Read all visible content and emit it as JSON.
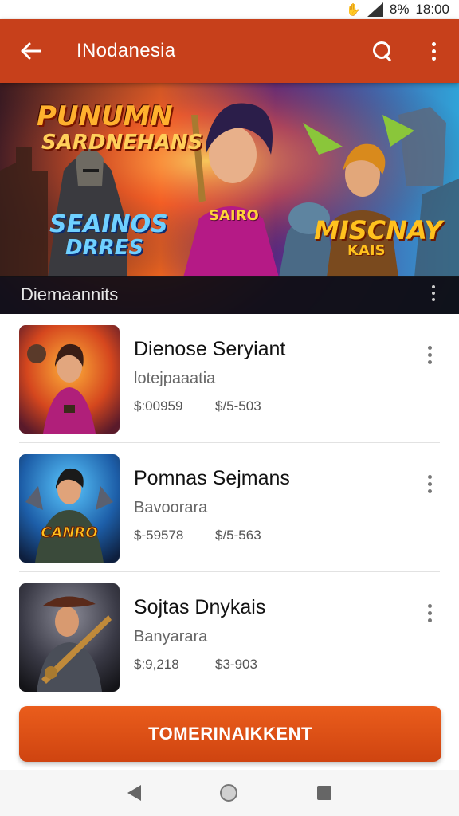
{
  "status_bar": {
    "battery": "8%",
    "time": "18:00"
  },
  "app_bar": {
    "title": "INodanesia"
  },
  "banner": {
    "art_text": [
      "PUNUMN",
      "SARDNEHANS",
      "SEAINOS",
      "DRRES",
      "SAIRO",
      "MISCNAY",
      "KAIS"
    ],
    "caption": "Diemaannits"
  },
  "items": [
    {
      "title": "Dienose Seryiant",
      "subtitle": "lotejpaaatia",
      "price_a": "$:00959",
      "price_b": "$/5-503",
      "thumb_text": ""
    },
    {
      "title": "Pomnas Sejmans",
      "subtitle": "Bavoorara",
      "price_a": "$-59578",
      "price_b": "$/5-563",
      "thumb_text": "CANRO"
    },
    {
      "title": "Sojtas Dnykais",
      "subtitle": "Banyarara",
      "price_a": "$:9,218",
      "price_b": "$3-903",
      "thumb_text": ""
    }
  ],
  "cta": {
    "label": "TOMERINAIKKENT"
  },
  "colors": {
    "app_bar": "#c7401b",
    "cta": "#e4531a"
  }
}
